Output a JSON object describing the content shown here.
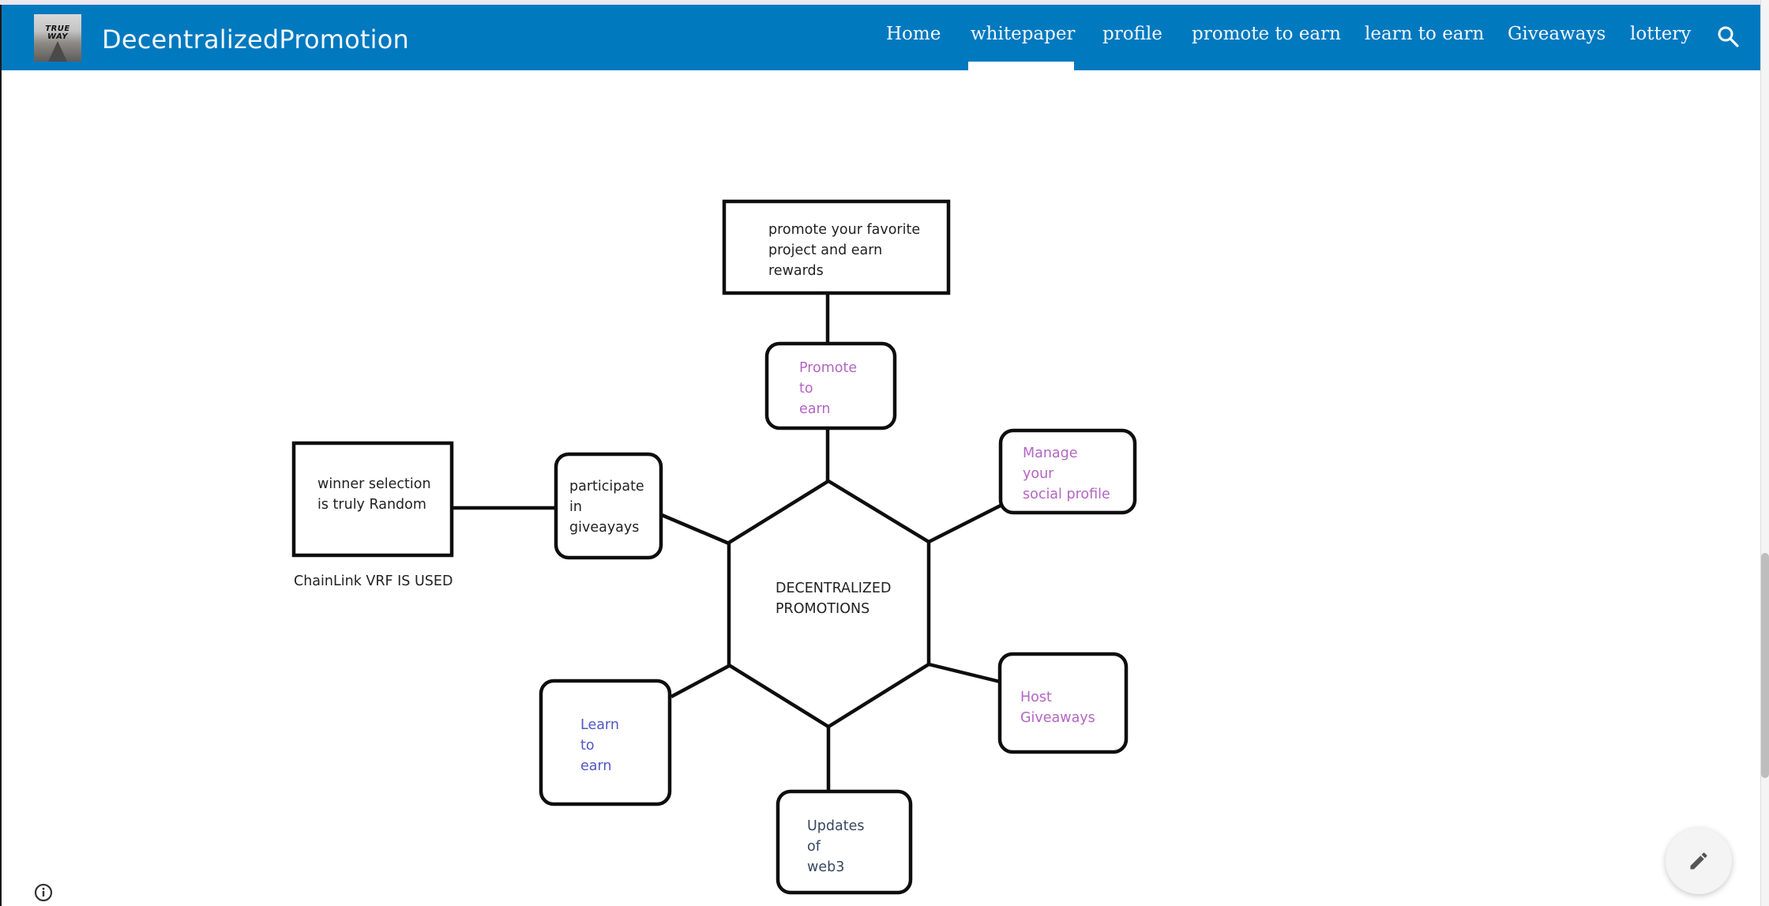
{
  "header": {
    "site_title": "DecentralizedPromotion",
    "logo_text": "TRUE\nWAY",
    "logo_icon": "site-logo-image",
    "nav": [
      {
        "label": "Home",
        "active": false
      },
      {
        "label": "whitepaper",
        "active": true
      },
      {
        "label": "profile",
        "active": false
      },
      {
        "label": "promote to earn",
        "active": false
      },
      {
        "label": "learn to earn",
        "active": false
      },
      {
        "label": "Giveaways",
        "active": false
      },
      {
        "label": "lottery",
        "active": false
      }
    ],
    "search_icon": "search-icon"
  },
  "colors": {
    "header_bg": "#0079bf",
    "purple_text": "#b366c2",
    "blue_text": "#5157c6"
  },
  "diagram": {
    "center": "DECENTRALIZED\nPROMOTIONS",
    "top_box": "promote your favorite\nproject and earn\nrewards",
    "promote_box": "Promote\nto\nearn",
    "manage_box": "Manage\nyour\nsocial profile",
    "host_box": "Host\nGiveaways",
    "updates_box": "Updates\nof\nweb3",
    "learn_box": "Learn\nto\nearn",
    "participate_box": "participate\nin\ngiveayays",
    "winner_box": "winner selection\nis truly Random",
    "caption": "ChainLink VRF IS USED"
  },
  "footer": {
    "info_icon": "info-icon",
    "edit_icon": "edit-pencil-icon"
  }
}
